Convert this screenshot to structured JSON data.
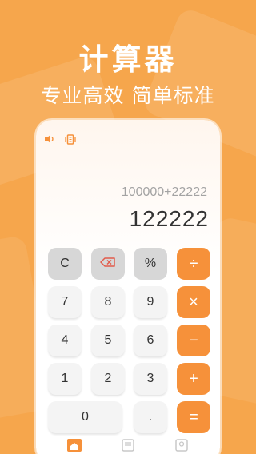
{
  "promo": {
    "title": "计算器",
    "subtitle": "专业高效 简单标准"
  },
  "status_icons": [
    "speaker-icon",
    "vibrate-icon"
  ],
  "display": {
    "expression": "100000+22222",
    "result": "122222"
  },
  "keys": {
    "clear": "C",
    "backspace_icon": "backspace-icon",
    "percent": "%",
    "divide": "÷",
    "seven": "7",
    "eight": "8",
    "nine": "9",
    "multiply": "×",
    "four": "4",
    "five": "5",
    "six": "6",
    "minus": "−",
    "one": "1",
    "two": "2",
    "three": "3",
    "plus": "+",
    "zero": "0",
    "dot": ".",
    "equals": "="
  },
  "bottom_nav": [
    "home-icon",
    "history-icon",
    "profile-icon"
  ],
  "colors": {
    "background": "#f6a64c",
    "accent": "#f6913a",
    "function_key": "#d7d7d7",
    "number_key": "#f4f4f4"
  }
}
